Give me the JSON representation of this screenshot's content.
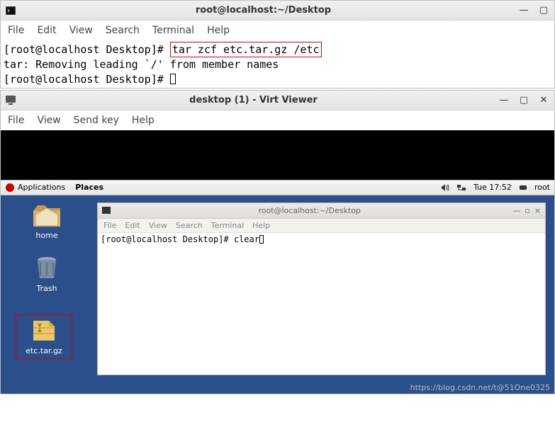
{
  "outer_terminal": {
    "title": "root@localhost:~/Desktop",
    "menu": [
      "File",
      "Edit",
      "View",
      "Search",
      "Terminal",
      "Help"
    ],
    "line1_prompt": "[root@localhost Desktop]# ",
    "line1_cmd": "tar zcf etc.tar.gz /etc",
    "line2": "tar: Removing leading `/' from member names",
    "line3_prompt": "[root@localhost Desktop]# "
  },
  "virt_viewer": {
    "title": "desktop (1) - Virt Viewer",
    "menu": [
      "File",
      "View",
      "Send key",
      "Help"
    ]
  },
  "gnome": {
    "apps": "Applications",
    "places": "Places",
    "clock": "Tue 17:52",
    "user": "root"
  },
  "desktop_icons": {
    "home": "home",
    "trash": "Trash",
    "archive": "etc.tar.gz"
  },
  "inner_terminal": {
    "title": "root@localhost:~/Desktop",
    "menu": [
      "File",
      "Edit",
      "View",
      "Search",
      "Terminal",
      "Help"
    ],
    "prompt": "[root@localhost Desktop]# ",
    "cmd": "clear"
  },
  "watermark": "https://blog.csdn.net/t@51One0325"
}
